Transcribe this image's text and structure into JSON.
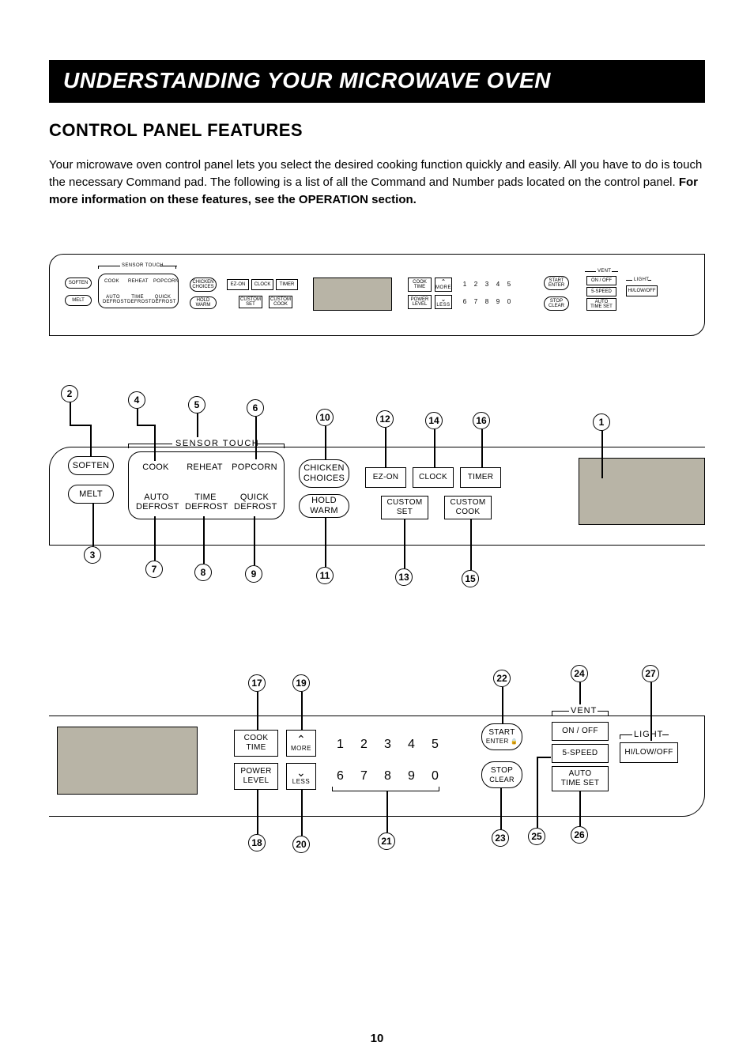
{
  "title": "UNDERSTANDING YOUR MICROWAVE OVEN",
  "subhead": "CONTROL PANEL FEATURES",
  "intro_a": "Your microwave oven control panel lets you select the desired cooking function quickly and easily. All you have to do is touch the necessary Command pad. The following is a list of all the Command and Number pads located on the control panel. ",
  "intro_b": "For more information on these features, see the OPERATION section.",
  "page_number": "10",
  "sensor_label": "SENSOR TOUCH",
  "pills": {
    "soften": "SOFTEN",
    "melt": "MELT",
    "chicken_choices_l1": "CHICKEN",
    "chicken_choices_l2": "CHOICES",
    "hold_warm_l1": "HOLD",
    "hold_warm_l2": "WARM",
    "start": "START",
    "enter": "ENTER",
    "stop": "STOP",
    "clear": "CLEAR"
  },
  "rects": {
    "ezon": "EZ-ON",
    "clock": "CLOCK",
    "timer": "TIMER",
    "custom_set_l1": "CUSTOM",
    "custom_set_l2": "SET",
    "custom_cook_l1": "CUSTOM",
    "custom_cook_l2": "COOK",
    "cook_time_l1": "COOK",
    "cook_time_l2": "TIME",
    "power_level_l1": "POWER",
    "power_level_l2": "LEVEL",
    "more": "MORE",
    "less": "LESS",
    "on_off": "ON / OFF",
    "five_speed": "5-SPEED",
    "auto_time_set_l1": "AUTO",
    "auto_time_set_l2": "TIME SET",
    "hi_low_off": "HI/LOW/OFF"
  },
  "sensor_txt": {
    "cook": "COOK",
    "reheat": "REHEAT",
    "popcorn": "POPCORN",
    "auto_defrost_l1": "AUTO",
    "auto_defrost_l2": "DEFROST",
    "time_defrost_l1": "TIME",
    "time_defrost_l2": "DEFROST",
    "quick_defrost_l1": "QUICK",
    "quick_defrost_l2": "DEFROST"
  },
  "section_labels": {
    "vent": "VENT",
    "light": "LIGHT"
  },
  "keypad": [
    "1",
    "2",
    "3",
    "4",
    "5",
    "6",
    "7",
    "8",
    "9",
    "0"
  ],
  "callouts": {
    "c1": "1",
    "c2": "2",
    "c3": "3",
    "c4": "4",
    "c5": "5",
    "c6": "6",
    "c7": "7",
    "c8": "8",
    "c9": "9",
    "c10": "10",
    "c11": "11",
    "c12": "12",
    "c13": "13",
    "c14": "14",
    "c15": "15",
    "c16": "16",
    "c17": "17",
    "c18": "18",
    "c19": "19",
    "c20": "20",
    "c21": "21",
    "c22": "22",
    "c23": "23",
    "c24": "24",
    "c25": "25",
    "c26": "26",
    "c27": "27"
  }
}
